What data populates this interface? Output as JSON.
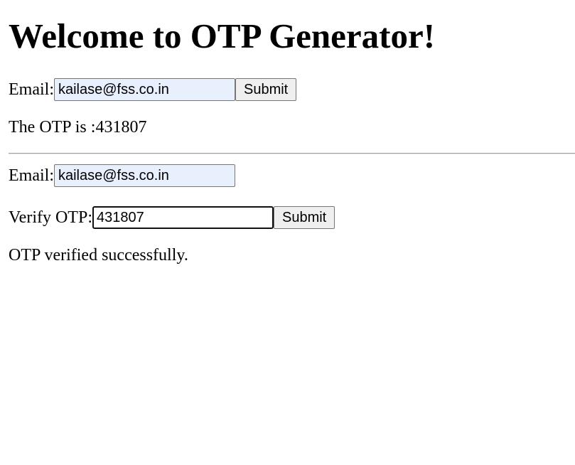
{
  "page": {
    "title": "Welcome to OTP Generator!"
  },
  "generate_form": {
    "email_label": "Email:",
    "email_value": "kailase@fss.co.in",
    "submit_label": "Submit",
    "result_text": "The OTP is :431807"
  },
  "verify_form": {
    "email_label": "Email:",
    "email_value": "kailase@fss.co.in",
    "otp_label": "Verify OTP:",
    "otp_value": "431807",
    "submit_label": "Submit",
    "result_text": "OTP verified successfully."
  }
}
